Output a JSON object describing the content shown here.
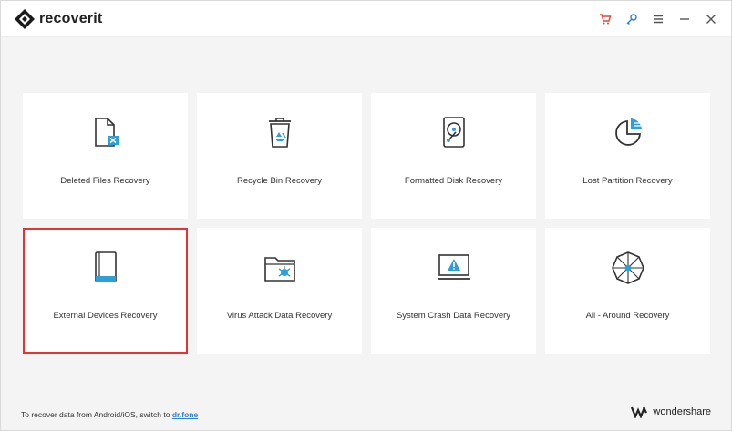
{
  "app": {
    "title": "recoverit"
  },
  "titlebar": {
    "icons": [
      "cart-icon",
      "key-icon",
      "menu-icon",
      "minimize-icon",
      "close-icon"
    ],
    "colors": {
      "cart": "#e0463a",
      "key": "#2f7fd1",
      "default": "#555555"
    }
  },
  "cards": [
    {
      "label": "Deleted Files Recovery",
      "icon": "deleted-file-icon"
    },
    {
      "label": "Recycle Bin Recovery",
      "icon": "recycle-bin-icon"
    },
    {
      "label": "Formatted Disk Recovery",
      "icon": "formatted-disk-icon"
    },
    {
      "label": "Lost Partition Recovery",
      "icon": "lost-partition-icon"
    },
    {
      "label": "External Devices Recovery",
      "icon": "external-device-icon",
      "selected": true
    },
    {
      "label": "Virus Attack Data Recovery",
      "icon": "virus-folder-icon"
    },
    {
      "label": "System Crash Data Recovery",
      "icon": "system-crash-icon"
    },
    {
      "label": "All - Around Recovery",
      "icon": "all-around-icon"
    }
  ],
  "footer": {
    "prefix": "To recover data from Android/iOS, switch to",
    "link": "dr.fone",
    "brand": "wondershare"
  },
  "colors": {
    "accent": "#2f9fd8",
    "selected_border": "#e53333"
  }
}
